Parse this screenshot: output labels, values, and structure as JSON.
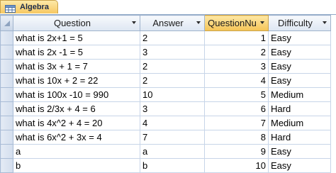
{
  "tab": {
    "label": "Algebra",
    "icon": "table-icon"
  },
  "columns": [
    {
      "label": "Question",
      "icon": "dropdown-arrow-icon"
    },
    {
      "label": "Answer",
      "icon": "dropdown-arrow-icon"
    },
    {
      "label": "QuestionNu",
      "icon": "dropdown-arrow-icon",
      "active": true
    },
    {
      "label": "Difficulty",
      "icon": "dropdown-arrow-icon"
    }
  ],
  "rows": [
    {
      "question": "what is 2x+1 = 5",
      "answer": "2",
      "number": "1",
      "difficulty": "Easy"
    },
    {
      "question": "what is 2x -1 = 5",
      "answer": "3",
      "number": "2",
      "difficulty": "Easy"
    },
    {
      "question": "what is 3x + 1 = 7",
      "answer": "2",
      "number": "3",
      "difficulty": "Easy"
    },
    {
      "question": "what is 10x + 2 = 22",
      "answer": "2",
      "number": "4",
      "difficulty": "Easy"
    },
    {
      "question": "what is 100x -10 = 990",
      "answer": "10",
      "number": "5",
      "difficulty": "Medium"
    },
    {
      "question": "what is 2/3x + 4 = 6",
      "answer": "3",
      "number": "6",
      "difficulty": "Hard"
    },
    {
      "question": "what is 4x^2 + 4 = 20",
      "answer": "4",
      "number": "7",
      "difficulty": "Medium"
    },
    {
      "question": "what is 6x^2 + 3x = 4",
      "answer": "7",
      "number": "8",
      "difficulty": "Hard"
    },
    {
      "question": "a",
      "answer": "a",
      "number": "9",
      "difficulty": "Easy"
    },
    {
      "question": "b",
      "answer": "b",
      "number": "10",
      "difficulty": "Easy"
    }
  ],
  "colors": {
    "accent": "#f7c862",
    "header_bg": "#dde6f2",
    "grid_line": "#c7d5e8"
  }
}
